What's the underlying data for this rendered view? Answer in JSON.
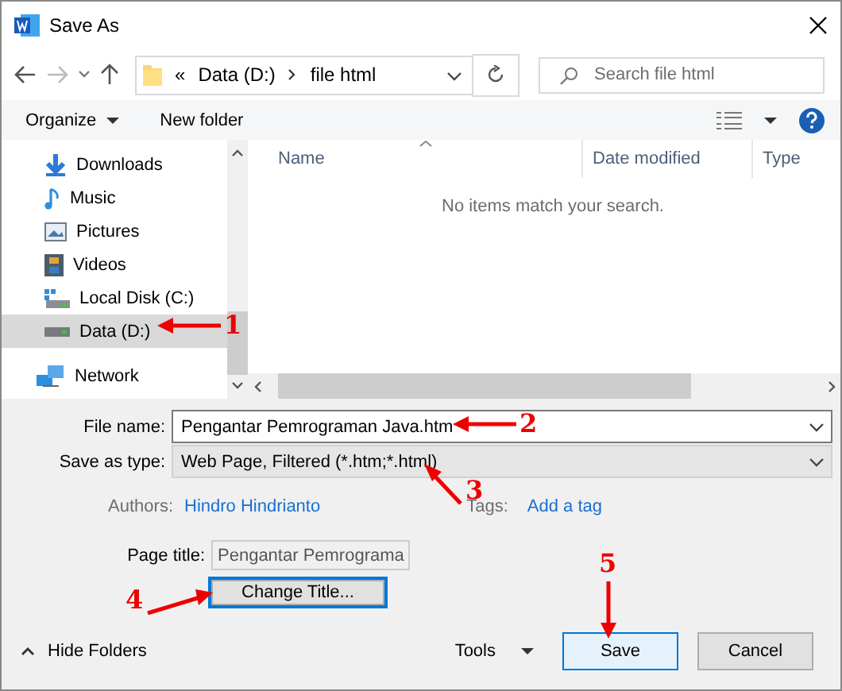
{
  "window": {
    "title": "Save As"
  },
  "nav": {
    "overflow": "«",
    "crumbs": [
      "Data (D:)",
      "file html"
    ]
  },
  "search": {
    "placeholder": "Search file html"
  },
  "toolbar": {
    "organize": "Organize",
    "new_folder": "New folder"
  },
  "sidebar": {
    "items": [
      {
        "label": "Downloads",
        "kind": "downloads",
        "selected": false
      },
      {
        "label": "Music",
        "kind": "music",
        "selected": false
      },
      {
        "label": "Pictures",
        "kind": "pictures",
        "selected": false
      },
      {
        "label": "Videos",
        "kind": "videos",
        "selected": false
      },
      {
        "label": "Local Disk (C:)",
        "kind": "system-drive",
        "selected": false
      },
      {
        "label": "Data (D:)",
        "kind": "drive",
        "selected": true
      },
      {
        "label": "Network",
        "kind": "network",
        "selected": false
      }
    ]
  },
  "file_list": {
    "columns": [
      "Name",
      "Date modified",
      "Type"
    ],
    "empty_message": "No items match your search."
  },
  "form": {
    "file_name": {
      "label": "File name:",
      "value": "Pengantar Pemrograman Java.htm"
    },
    "save_as_type": {
      "label": "Save as type:",
      "value": "Web Page, Filtered (*.htm;*.html)"
    },
    "authors": {
      "label": "Authors:",
      "value": "Hindro Hindrianto"
    },
    "tags": {
      "label": "Tags:",
      "value": "Add a tag"
    },
    "page_title": {
      "label": "Page title:",
      "value": "Pengantar Pemrograma"
    },
    "change_title": "Change Title..."
  },
  "footer": {
    "hide_folders": "Hide Folders",
    "tools": "Tools",
    "buttons": [
      "Save",
      "Cancel"
    ]
  },
  "annotations": [
    {
      "number": "1",
      "kind": "left"
    },
    {
      "number": "2",
      "kind": "left"
    },
    {
      "number": "3",
      "kind": "up-left"
    },
    {
      "number": "4",
      "kind": "up-right"
    },
    {
      "number": "5",
      "kind": "down"
    }
  ]
}
